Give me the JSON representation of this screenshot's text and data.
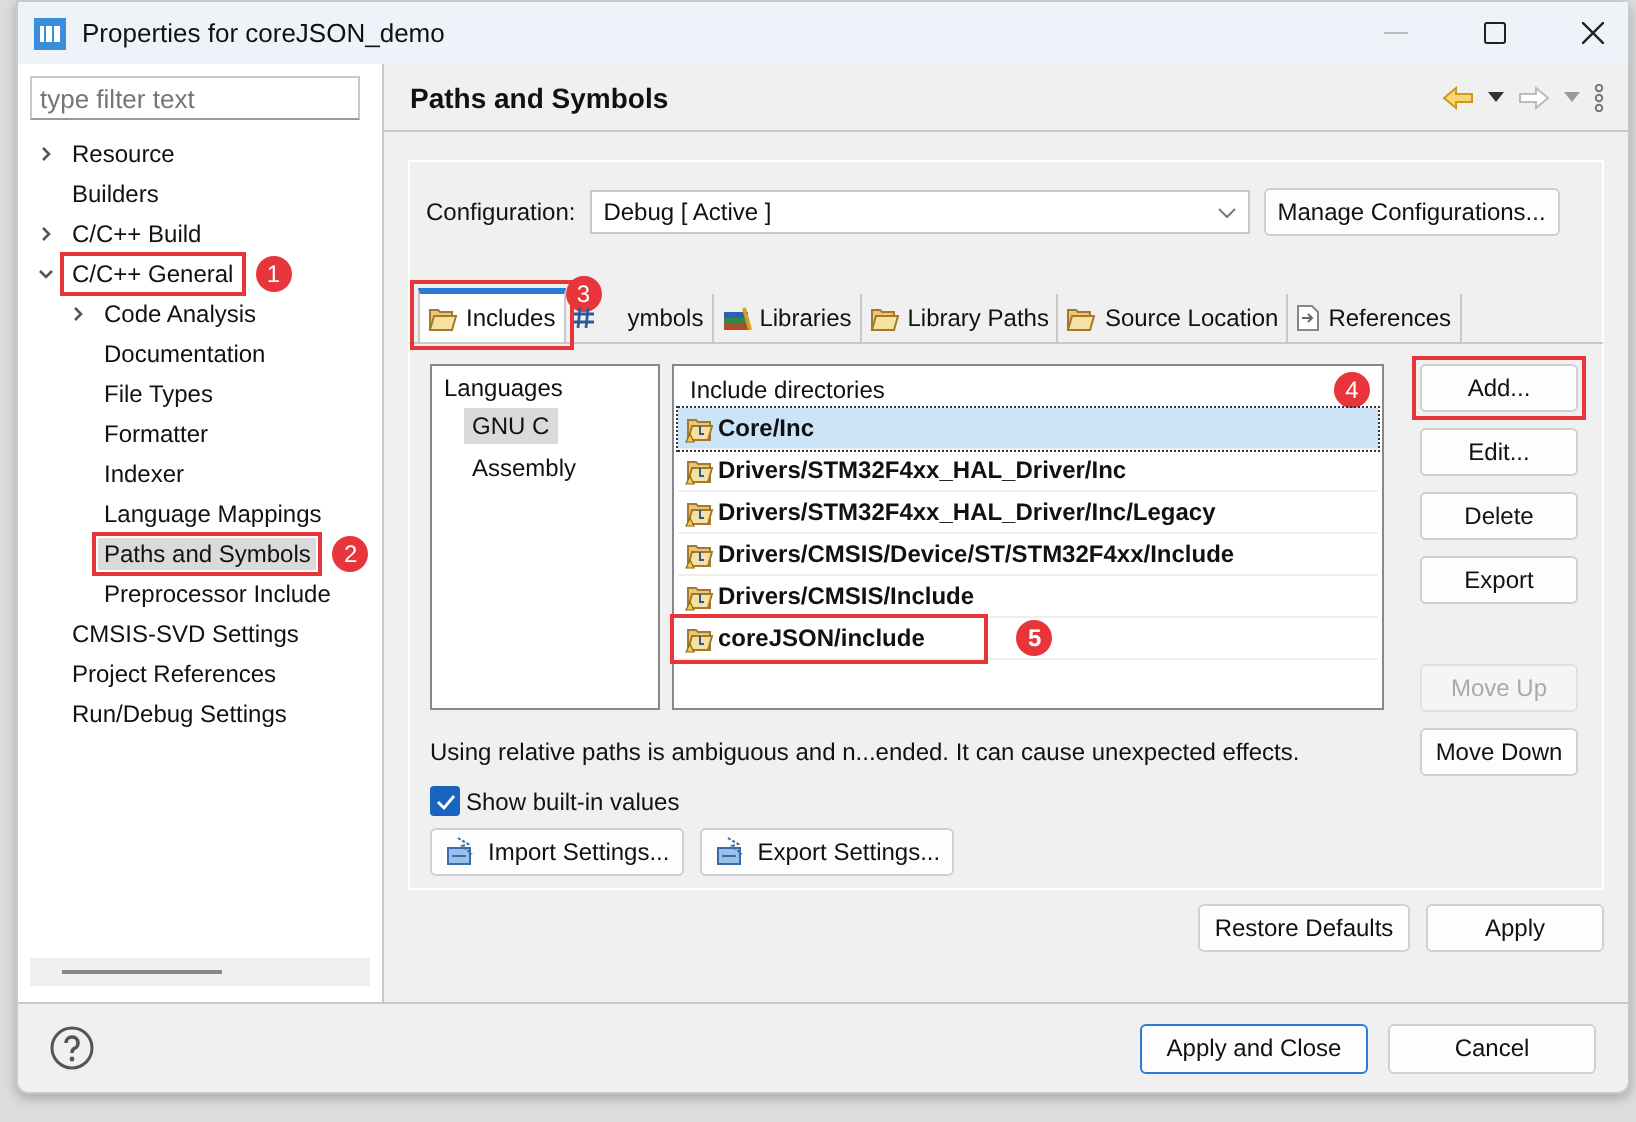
{
  "window": {
    "title": "Properties for coreJSON_demo"
  },
  "sidebar": {
    "filter": {
      "placeholder": "type filter text"
    },
    "items": [
      {
        "label": "Resource",
        "kind": "folder",
        "expanded": false,
        "selected": false
      },
      {
        "label": "Builders",
        "kind": "leaf",
        "selected": false
      },
      {
        "label": "C/C++ Build",
        "kind": "folder",
        "expanded": false,
        "selected": false
      },
      {
        "label": "C/C++ General",
        "kind": "folder",
        "expanded": true,
        "selected": false,
        "callout": "1",
        "children": [
          {
            "label": "Code Analysis",
            "kind": "folder",
            "expanded": false,
            "selected": false
          },
          {
            "label": "Documentation",
            "kind": "leaf",
            "selected": false
          },
          {
            "label": "File Types",
            "kind": "leaf",
            "selected": false
          },
          {
            "label": "Formatter",
            "kind": "leaf",
            "selected": false
          },
          {
            "label": "Indexer",
            "kind": "leaf",
            "selected": false
          },
          {
            "label": "Language Mappings",
            "kind": "leaf",
            "selected": false
          },
          {
            "label": "Paths and Symbols",
            "kind": "leaf",
            "selected": true,
            "callout": "2"
          },
          {
            "label": "Preprocessor Include",
            "kind": "leaf",
            "selected": false
          }
        ]
      },
      {
        "label": "CMSIS-SVD Settings",
        "kind": "leaf",
        "selected": false
      },
      {
        "label": "Project References",
        "kind": "leaf",
        "selected": false
      },
      {
        "label": "Run/Debug Settings",
        "kind": "leaf",
        "selected": false
      }
    ]
  },
  "page": {
    "title": "Paths and Symbols",
    "configuration": {
      "label": "Configuration:",
      "value": "Debug  [ Active ]",
      "button": "Manage Configurations..."
    },
    "tabs": [
      {
        "label": "Includes",
        "selected": true,
        "callout": "3"
      },
      {
        "label": "ymbols",
        "selected": false
      },
      {
        "label": "Libraries",
        "selected": false
      },
      {
        "label": "Library Paths",
        "selected": false
      },
      {
        "label": "Source Location",
        "selected": false
      },
      {
        "label": "References",
        "selected": false
      }
    ],
    "languages": {
      "heading": "Languages",
      "items": [
        {
          "label": "GNU C",
          "selected": true
        },
        {
          "label": "Assembly",
          "selected": false
        }
      ]
    },
    "includes": {
      "heading": "Include directories",
      "callout": "4",
      "rows": [
        {
          "path": "Core/Inc",
          "selected": true
        },
        {
          "path": "Drivers/STM32F4xx_HAL_Driver/Inc",
          "selected": false
        },
        {
          "path": "Drivers/STM32F4xx_HAL_Driver/Inc/Legacy",
          "selected": false
        },
        {
          "path": "Drivers/CMSIS/Device/ST/STM32F4xx/Include",
          "selected": false
        },
        {
          "path": "Drivers/CMSIS/Include",
          "selected": false
        },
        {
          "path": "coreJSON/include",
          "selected": false,
          "callout": "5"
        }
      ]
    },
    "side_buttons": [
      {
        "label": "Add...",
        "disabled": false,
        "highlighted": true
      },
      {
        "label": "Edit...",
        "disabled": false,
        "highlighted": false
      },
      {
        "label": "Delete",
        "disabled": false,
        "highlighted": false
      },
      {
        "label": "Export",
        "disabled": false,
        "highlighted": false
      },
      {
        "label": "Move Up",
        "disabled": true,
        "highlighted": false
      },
      {
        "label": "Move Down",
        "disabled": false,
        "highlighted": false
      }
    ],
    "note": "Using relative paths is ambiguous and n...ended. It can cause unexpected effects.",
    "show_builtin": {
      "label": "Show built-in values",
      "checked": true
    },
    "settings_buttons": [
      "Import Settings...",
      "Export Settings..."
    ],
    "buttons": [
      "Restore Defaults",
      "Apply"
    ]
  },
  "footer": {
    "buttons": [
      {
        "label": "Apply and Close",
        "default": true
      },
      {
        "label": "Cancel",
        "default": false
      }
    ]
  }
}
